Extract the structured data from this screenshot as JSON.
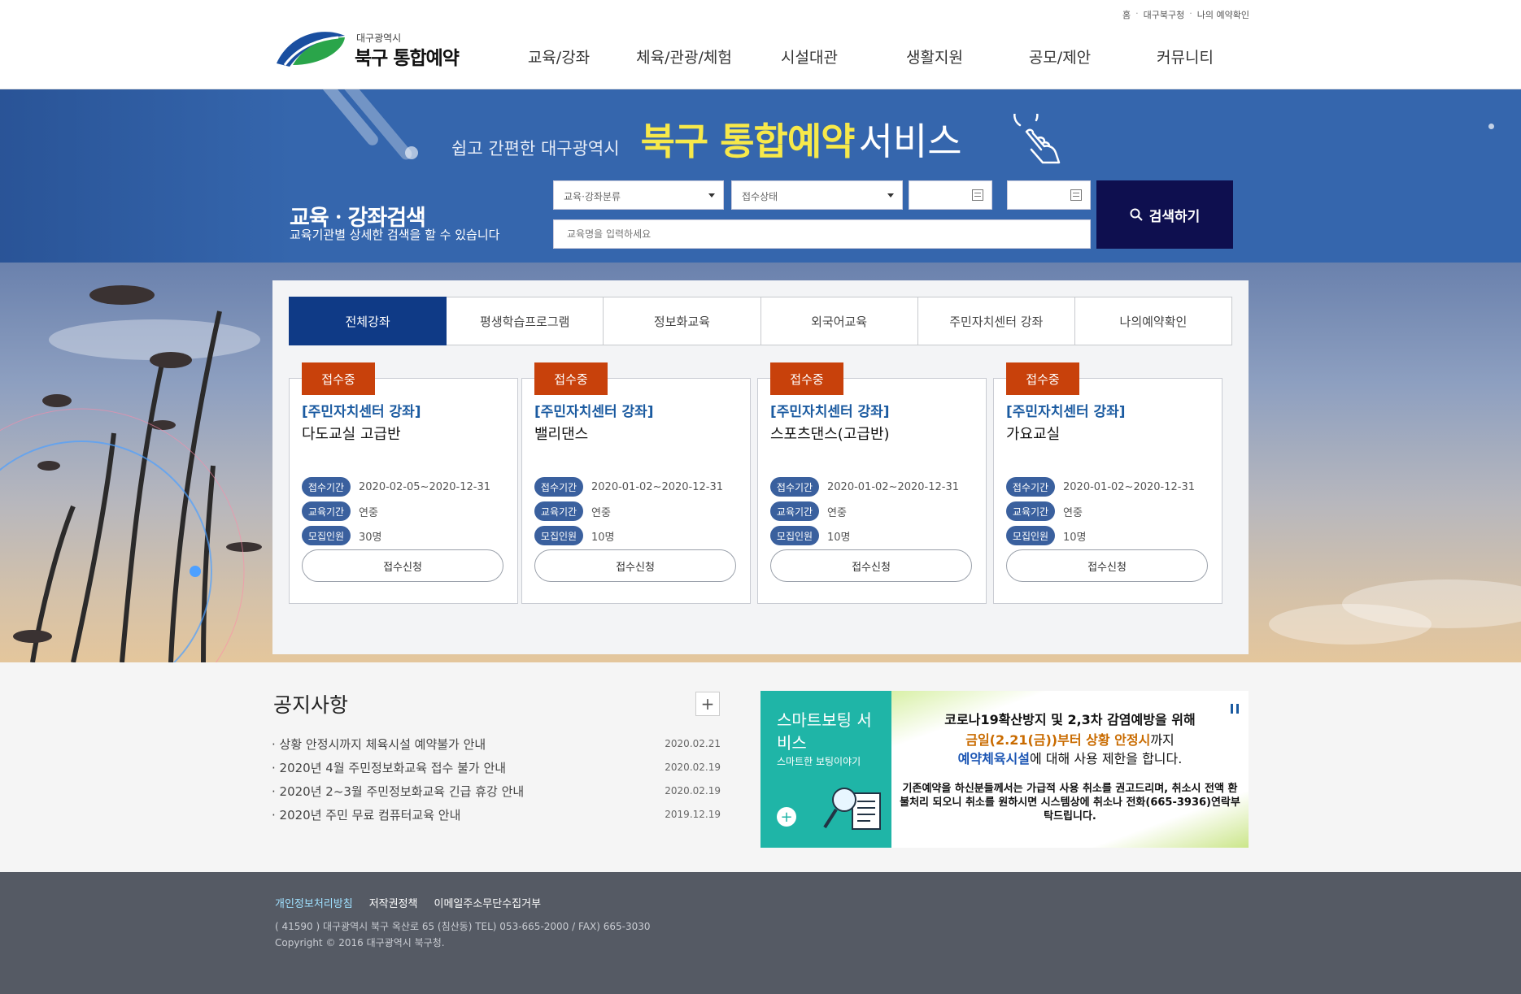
{
  "header": {
    "util_links": [
      "홈",
      "대구북구청",
      "나의 예약확인"
    ],
    "logo_small": "대구광역시",
    "logo_big": "북구 통합예약",
    "nav": [
      "교육/강좌",
      "체육/관광/체험",
      "시설대관",
      "생활지원",
      "공모/제안",
      "커뮤니티"
    ]
  },
  "hero": {
    "slogan_sub": "쉽고 간편한 대구광역시",
    "slogan_main": "북구 통합예약",
    "slogan_tail": "서비스",
    "search_title": "교육ㆍ강좌검색",
    "search_desc": "교육기관별 상세한 검색을 할 수 있습니다",
    "select_category": "교육·강좌분류",
    "select_status": "접수상태",
    "date_from": "",
    "date_to": "",
    "keyword_placeholder": "교육명을 입력하세요",
    "search_button": "검색하기"
  },
  "tabs": [
    "전체강좌",
    "평생학습프로그램",
    "정보화교육",
    "외국어교육",
    "주민자치센터 강좌",
    "나의예약확인"
  ],
  "row_labels": {
    "receipt": "접수기간",
    "edu": "교육기간",
    "recruit": "모집인원"
  },
  "apply_label": "접수신청",
  "courses": [
    {
      "badge": "접수중",
      "category": "[주민자치센터 강좌]",
      "title": "다도교실 고급반",
      "receipt": "2020-02-05~2020-12-31",
      "edu": "연중",
      "recruit": "30명"
    },
    {
      "badge": "접수중",
      "category": "[주민자치센터 강좌]",
      "title": "밸리댄스",
      "receipt": "2020-01-02~2020-12-31",
      "edu": "연중",
      "recruit": "10명"
    },
    {
      "badge": "접수중",
      "category": "[주민자치센터 강좌]",
      "title": "스포츠댄스(고급반)",
      "receipt": "2020-01-02~2020-12-31",
      "edu": "연중",
      "recruit": "10명"
    },
    {
      "badge": "접수중",
      "category": "[주민자치센터 강좌]",
      "title": "가요교실",
      "receipt": "2020-01-02~2020-12-31",
      "edu": "연중",
      "recruit": "10명"
    }
  ],
  "notice": {
    "title": "공지사항",
    "more": "+",
    "items": [
      {
        "text": "· 상황 안정시까지 체육시설 예약불가 안내",
        "date": "2020.02.21"
      },
      {
        "text": "· 2020년 4월 주민정보화교육 접수 불가 안내",
        "date": "2020.02.19"
      },
      {
        "text": "· 2020년 2~3월 주민정보화교육 긴급 휴강 안내",
        "date": "2020.02.19"
      },
      {
        "text": "· 2020년 주민 무료 컴퓨터교육 안내",
        "date": "2019.12.19"
      }
    ]
  },
  "banner": {
    "left_title": "스마트보팅 서비스",
    "left_sub": "스마트한 보팅이야기",
    "plus": "+",
    "line1": "코로나19확산방지 및 2,3차 감염예방을 위해",
    "line2_highlight": "금일(2.21(금))부터 상황 안정시",
    "line2_rest": "까지",
    "line3_highlight": "예약체육시설",
    "line3_rest": "에 대해 사용 제한을 합니다.",
    "line4": "기존예약을 하신분들께서는 가급적 사용 취소를 권고드리며, 취소시 전액 환불처리 되오니 취소를 원하시면 시스템상에 취소나 전화(665-3936)연락부탁드립니다."
  },
  "footer": {
    "links": [
      "개인정보처리방침",
      "저작권정책",
      "이메일주소무단수집거부"
    ],
    "address": "( 41590 ) 대구광역시 북구 옥산로 65 (침산동)   TEL) 053-665-2000 / FAX) 665-3030",
    "copyright": "Copyright © 2016 대구광역시 북구청."
  },
  "colors": {
    "brand_blue": "#3566ad",
    "tab_active": "#0f3a86",
    "search_button": "#0e0f4f",
    "badge": "#c8410b",
    "slogan_yellow": "#f7e94a",
    "banner_teal": "#1fb5a7",
    "footer": "#555a64"
  }
}
